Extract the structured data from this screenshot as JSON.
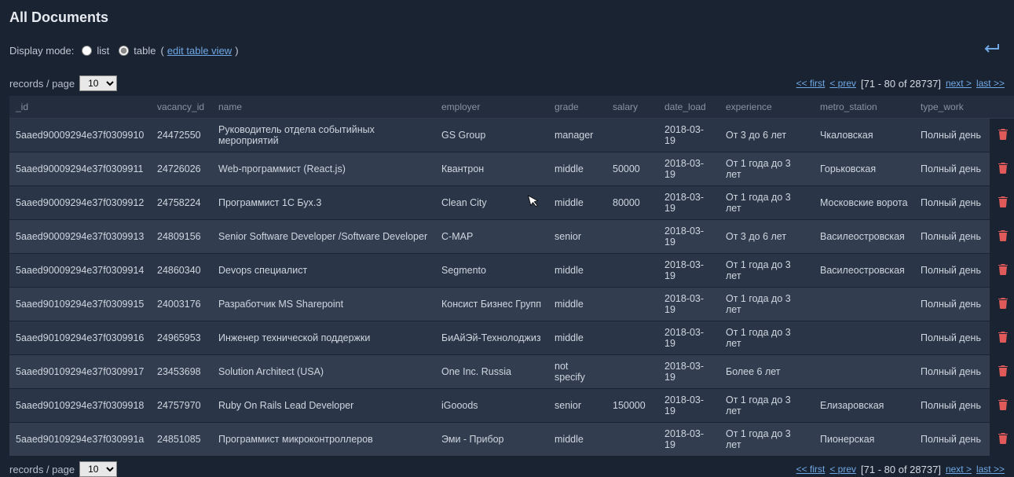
{
  "title": "All Documents",
  "displayMode": {
    "label": "Display mode:",
    "list": "list",
    "table": "table",
    "editLink": "edit table view"
  },
  "recordsLabel": "records / page",
  "pageSizeOptions": [
    "10"
  ],
  "pageSize": "10",
  "pager": {
    "first": "<< first",
    "prev": "< prev",
    "info": "[71 - 80 of 28737]",
    "next": "next >",
    "last": "last >>"
  },
  "columns": [
    "_id",
    "vacancy_id",
    "name",
    "employer",
    "grade",
    "salary",
    "date_load",
    "experience",
    "metro_station",
    "type_work"
  ],
  "rows": [
    {
      "_id": "5aaed90009294e37f0309910",
      "vacancy_id": "24472550",
      "name": "Руководитель отдела событийных мероприятий",
      "employer": "GS Group",
      "grade": "manager",
      "salary": "",
      "date_load": "2018-03-19",
      "experience": "От 3 до 6 лет",
      "metro_station": "Чкаловская",
      "type_work": "Полный день"
    },
    {
      "_id": "5aaed90009294e37f0309911",
      "vacancy_id": "24726026",
      "name": "Web-программист (React.js)",
      "employer": "Квантрон",
      "grade": "middle",
      "salary": "50000",
      "date_load": "2018-03-19",
      "experience": "От 1 года до 3 лет",
      "metro_station": "Горьковская",
      "type_work": "Полный день"
    },
    {
      "_id": "5aaed90009294e37f0309912",
      "vacancy_id": "24758224",
      "name": "Программист 1С Бух.3",
      "employer": "Clean City",
      "grade": "middle",
      "salary": "80000",
      "date_load": "2018-03-19",
      "experience": "От 1 года до 3 лет",
      "metro_station": "Московские ворота",
      "type_work": "Полный день"
    },
    {
      "_id": "5aaed90009294e37f0309913",
      "vacancy_id": "24809156",
      "name": "Senior Software Developer /Software Developer",
      "employer": "C-MAP",
      "grade": "senior",
      "salary": "",
      "date_load": "2018-03-19",
      "experience": "От 3 до 6 лет",
      "metro_station": "Василеостровская",
      "type_work": "Полный день"
    },
    {
      "_id": "5aaed90009294e37f0309914",
      "vacancy_id": "24860340",
      "name": "Devops специалист",
      "employer": "Segmento",
      "grade": "middle",
      "salary": "",
      "date_load": "2018-03-19",
      "experience": "От 1 года до 3 лет",
      "metro_station": "Василеостровская",
      "type_work": "Полный день"
    },
    {
      "_id": "5aaed90109294e37f0309915",
      "vacancy_id": "24003176",
      "name": "Разработчик MS Sharepoint",
      "employer": "Консист Бизнес Групп",
      "grade": "middle",
      "salary": "",
      "date_load": "2018-03-19",
      "experience": "От 1 года до 3 лет",
      "metro_station": "",
      "type_work": "Полный день"
    },
    {
      "_id": "5aaed90109294e37f0309916",
      "vacancy_id": "24965953",
      "name": "Инженер технической поддержки",
      "employer": "БиАйЭй-Технолоджиз",
      "grade": "middle",
      "salary": "",
      "date_load": "2018-03-19",
      "experience": "От 1 года до 3 лет",
      "metro_station": "",
      "type_work": "Полный день"
    },
    {
      "_id": "5aaed90109294e37f0309917",
      "vacancy_id": "23453698",
      "name": "Solution Architect (USA)",
      "employer": "One Inc. Russia",
      "grade": "not specify",
      "salary": "",
      "date_load": "2018-03-19",
      "experience": "Более 6 лет",
      "metro_station": "",
      "type_work": "Полный день"
    },
    {
      "_id": "5aaed90109294e37f0309918",
      "vacancy_id": "24757970",
      "name": "Ruby On Rails Lead Developer",
      "employer": "iGooods",
      "grade": "senior",
      "salary": "150000",
      "date_load": "2018-03-19",
      "experience": "От 1 года до 3 лет",
      "metro_station": "Елизаровская",
      "type_work": "Полный день"
    },
    {
      "_id": "5aaed90109294e37f030991a",
      "vacancy_id": "24851085",
      "name": "Программист микроконтроллеров",
      "employer": "Эми - Прибор",
      "grade": "middle",
      "salary": "",
      "date_load": "2018-03-19",
      "experience": "От 1 года до 3 лет",
      "metro_station": "Пионерская",
      "type_work": "Полный день"
    }
  ]
}
